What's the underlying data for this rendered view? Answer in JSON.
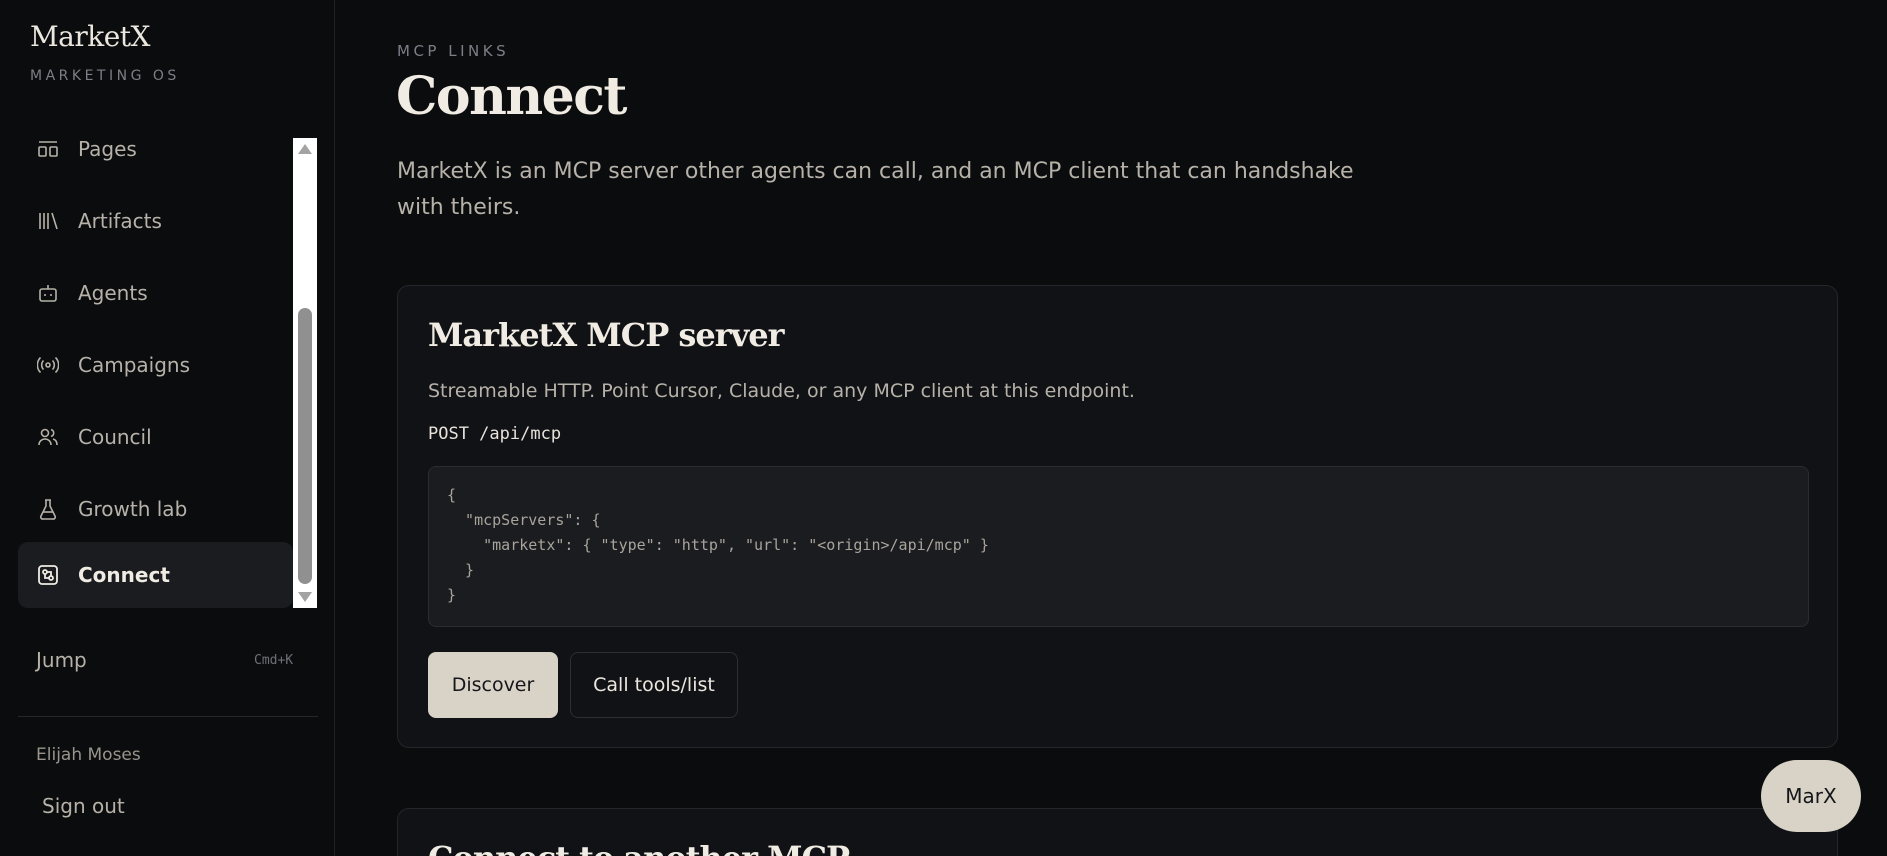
{
  "brand": {
    "name": "MarketX",
    "subtitle": "MARKETING OS"
  },
  "sidebar": {
    "items": [
      {
        "label": "Pages",
        "icon": "layout-icon"
      },
      {
        "label": "Artifacts",
        "icon": "library-icon"
      },
      {
        "label": "Agents",
        "icon": "bot-icon"
      },
      {
        "label": "Campaigns",
        "icon": "broadcast-icon"
      },
      {
        "label": "Council",
        "icon": "users-icon"
      },
      {
        "label": "Growth lab",
        "icon": "flask-icon"
      },
      {
        "label": "Connect",
        "icon": "connect-icon",
        "active": true
      }
    ],
    "jump_label": "Jump",
    "jump_shortcut": "Cmd+K",
    "user_name": "Elijah Moses",
    "signout_label": "Sign out"
  },
  "header": {
    "eyebrow": "MCP LINKS",
    "title": "Connect",
    "lead": "MarketX is an MCP server other agents can call, and an MCP client that can handshake with theirs."
  },
  "server_card": {
    "title": "MarketX MCP server",
    "description": "Streamable HTTP. Point Cursor, Claude, or any MCP client at this endpoint.",
    "endpoint": "POST /api/mcp",
    "code": "{\n  \"mcpServers\": {\n    \"marketx\": { \"type\": \"http\", \"url\": \"<origin>/api/mcp\" }\n  }\n}",
    "primary_button": "Discover",
    "secondary_button": "Call tools/list"
  },
  "next_card": {
    "title": "Connect to another MCP"
  },
  "assistant": {
    "label": "MarX"
  },
  "colors": {
    "background": "#0b0c0e",
    "card": "#111215",
    "accent": "#d8d2c7",
    "text": "#f1ece3",
    "muted": "#b7b2a9"
  }
}
